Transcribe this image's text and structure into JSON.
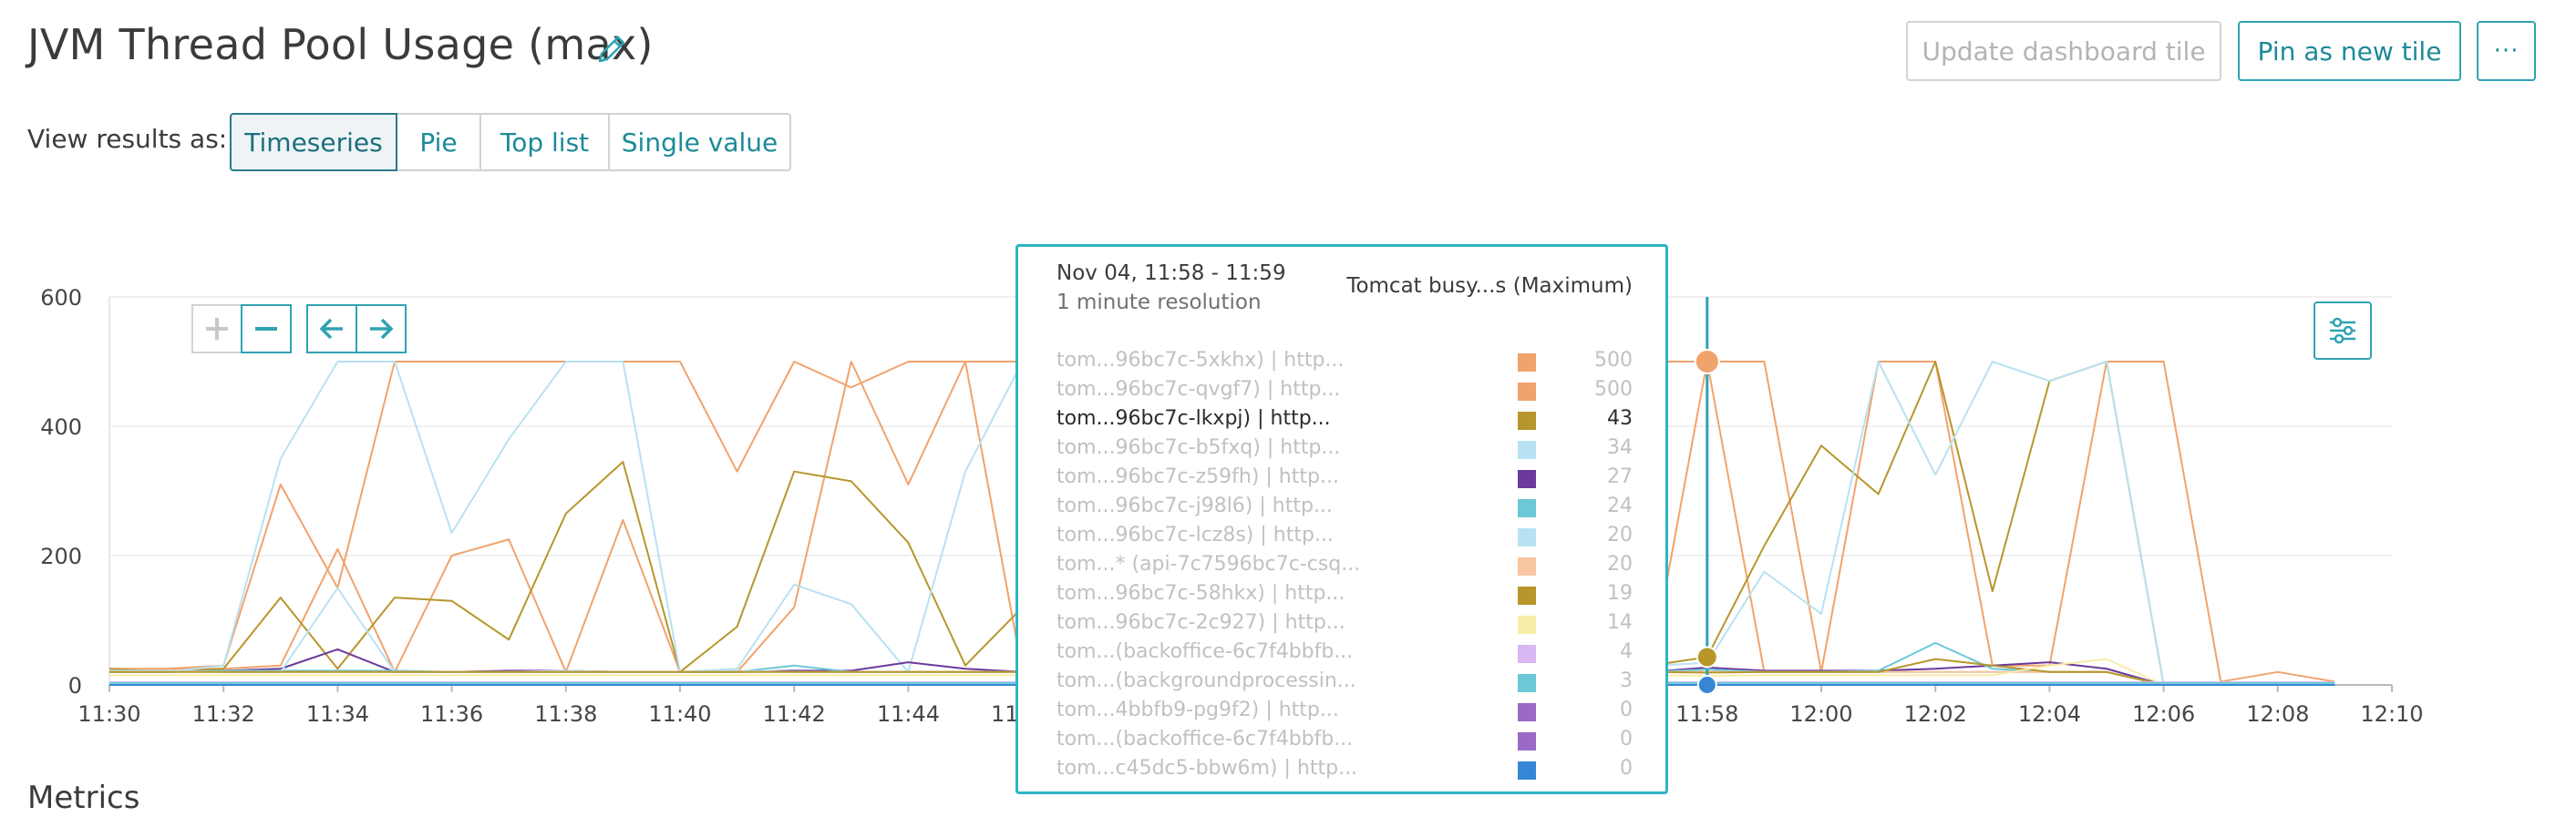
{
  "header": {
    "title": "JVM Thread Pool Usage (max)",
    "update_tile_label": "Update dashboard tile",
    "pin_tile_label": "Pin as new tile",
    "more_label": "···"
  },
  "view_results": {
    "label": "View results as:",
    "options": [
      "Timeseries",
      "Pie",
      "Top list",
      "Single value"
    ],
    "selected": "Timeseries"
  },
  "colors": {
    "accent": "#2fa3b2",
    "orange": "#f1a36c",
    "olive": "#b7962c",
    "light_blue": "#b8e2f2",
    "purple": "#6b3a9a",
    "teal": "#6cc7d7",
    "peach": "#f7c6a0",
    "pale_yellow": "#f8ecaa",
    "lavender": "#d8b7f2",
    "violet": "#9b6ac8",
    "blue": "#3587d6"
  },
  "chart_data": {
    "type": "line",
    "ylim": [
      0,
      600
    ],
    "yticks": [
      "0",
      "200",
      "400",
      "600"
    ],
    "xticks": [
      "11:30",
      "11:32",
      "11:34",
      "11:36",
      "11:38",
      "11:40",
      "11:42",
      "11:44",
      "11:46",
      "11:48",
      "11:50",
      "11:52",
      "11:54",
      "11:56",
      "11:58",
      "12:00",
      "12:02",
      "12:04",
      "12:06",
      "12:08",
      "12:10"
    ],
    "x": [
      "11:30",
      "11:31",
      "11:32",
      "11:33",
      "11:34",
      "11:35",
      "11:36",
      "11:37",
      "11:38",
      "11:39",
      "11:40",
      "11:41",
      "11:42",
      "11:43",
      "11:44",
      "11:45",
      "11:46",
      "11:47",
      "11:48",
      "11:49",
      "11:50",
      "11:51",
      "11:52",
      "11:53",
      "11:54",
      "11:55",
      "11:56",
      "11:57",
      "11:58",
      "11:59",
      "12:00",
      "12:01",
      "12:02",
      "12:03",
      "12:04",
      "12:05",
      "12:06",
      "12:07",
      "12:08",
      "12:09"
    ],
    "cursor": "11:58",
    "series": [
      {
        "name": "tom...96bc7c-5xkhx) | http...",
        "color": "#f1a36c",
        "values": [
          25,
          25,
          30,
          310,
          150,
          500,
          500,
          500,
          500,
          500,
          500,
          330,
          500,
          460,
          500,
          500,
          500,
          500,
          500,
          500,
          500,
          500,
          500,
          500,
          500,
          500,
          500,
          500,
          500,
          500,
          20,
          500,
          500,
          30,
          30,
          500,
          500,
          5,
          20,
          5
        ]
      },
      {
        "name": "tom...96bc7c-qvgf7) | http...",
        "color": "#f1a36c",
        "values": [
          20,
          25,
          25,
          30,
          210,
          20,
          200,
          225,
          20,
          255,
          20,
          20,
          120,
          500,
          310,
          500,
          20,
          20,
          20,
          20,
          20,
          20,
          20,
          20,
          20,
          20,
          20,
          20,
          500,
          20,
          20,
          20,
          20,
          20,
          20,
          20,
          0,
          0,
          0,
          0
        ]
      },
      {
        "name": "tom...96bc7c-lkxpj) | http...",
        "color": "#b7962c",
        "values": [
          25,
          20,
          25,
          135,
          25,
          135,
          130,
          70,
          265,
          345,
          20,
          90,
          330,
          315,
          220,
          30,
          120,
          30,
          30,
          30,
          30,
          30,
          30,
          30,
          30,
          30,
          30,
          30,
          43,
          215,
          370,
          295,
          500,
          145,
          470,
          500,
          0,
          0,
          0,
          0
        ]
      },
      {
        "name": "tom...96bc7c-b5fxq) | http...",
        "color": "#b8e2f2",
        "values": [
          20,
          20,
          30,
          350,
          500,
          500,
          235,
          380,
          500,
          500,
          20,
          25,
          155,
          125,
          20,
          330,
          500,
          500,
          30,
          30,
          30,
          30,
          30,
          30,
          30,
          30,
          30,
          30,
          34,
          175,
          110,
          500,
          325,
          500,
          470,
          500,
          0,
          0,
          0,
          0
        ]
      },
      {
        "name": "tom...96bc7c-z59fh) | http...",
        "color": "#6b3a9a",
        "values": [
          20,
          20,
          22,
          25,
          55,
          20,
          20,
          22,
          22,
          20,
          20,
          20,
          22,
          22,
          35,
          25,
          20,
          20,
          20,
          20,
          20,
          20,
          20,
          20,
          20,
          20,
          20,
          20,
          27,
          22,
          22,
          22,
          25,
          30,
          35,
          25,
          0,
          0,
          0,
          0
        ]
      },
      {
        "name": "tom...96bc7c-j98l6) | http...",
        "color": "#6cc7d7",
        "values": [
          20,
          20,
          22,
          22,
          22,
          22,
          20,
          20,
          20,
          20,
          20,
          20,
          30,
          20,
          20,
          20,
          20,
          20,
          20,
          20,
          20,
          20,
          20,
          20,
          20,
          20,
          20,
          20,
          24,
          20,
          20,
          22,
          65,
          25,
          20,
          20,
          0,
          0,
          0,
          0
        ]
      },
      {
        "name": "tom...96bc7c-lcz8s) | http...",
        "color": "#b8e2f2",
        "values": [
          22,
          22,
          20,
          20,
          150,
          20,
          20,
          20,
          22,
          20,
          20,
          22,
          20,
          20,
          20,
          20,
          20,
          20,
          20,
          20,
          20,
          20,
          20,
          20,
          20,
          20,
          20,
          20,
          20,
          20,
          20,
          20,
          20,
          20,
          20,
          20,
          0,
          0,
          0,
          0
        ]
      },
      {
        "name": "tom...* (api-7c7596bc7c-csq...",
        "color": "#f7c6a0",
        "values": [
          20,
          20,
          20,
          20,
          20,
          20,
          20,
          20,
          20,
          20,
          20,
          20,
          20,
          20,
          20,
          20,
          20,
          20,
          20,
          20,
          20,
          20,
          20,
          20,
          20,
          20,
          20,
          20,
          20,
          20,
          20,
          20,
          20,
          20,
          20,
          20,
          0,
          0,
          0,
          0
        ]
      },
      {
        "name": "tom...96bc7c-58hkx) | http...",
        "color": "#b7962c",
        "values": [
          20,
          20,
          20,
          20,
          20,
          20,
          20,
          20,
          20,
          20,
          20,
          20,
          20,
          20,
          20,
          20,
          20,
          20,
          20,
          20,
          20,
          20,
          20,
          20,
          20,
          20,
          20,
          20,
          19,
          20,
          20,
          20,
          40,
          30,
          20,
          20,
          0,
          0,
          0,
          0
        ]
      },
      {
        "name": "tom...96bc7c-2c927) | http...",
        "color": "#f8ecaa",
        "values": [
          15,
          15,
          15,
          15,
          15,
          15,
          15,
          15,
          15,
          15,
          15,
          15,
          15,
          15,
          15,
          15,
          15,
          15,
          15,
          15,
          15,
          15,
          15,
          15,
          15,
          15,
          15,
          15,
          14,
          15,
          15,
          15,
          15,
          15,
          30,
          40,
          0,
          0,
          0,
          0
        ]
      },
      {
        "name": "tom...(backoffice-6c7f4bbfb...",
        "color": "#d8b7f2",
        "values": [
          4,
          4,
          4,
          4,
          4,
          4,
          4,
          4,
          4,
          4,
          4,
          4,
          4,
          4,
          4,
          4,
          4,
          4,
          4,
          4,
          4,
          4,
          4,
          4,
          4,
          4,
          4,
          4,
          4,
          4,
          4,
          4,
          4,
          4,
          4,
          4,
          4,
          4,
          4,
          4
        ]
      },
      {
        "name": "tom...(backgroundprocessin...",
        "color": "#6cc7d7",
        "values": [
          3,
          3,
          3,
          3,
          3,
          3,
          3,
          3,
          3,
          3,
          3,
          3,
          3,
          3,
          3,
          3,
          3,
          3,
          3,
          3,
          3,
          3,
          3,
          3,
          3,
          3,
          3,
          3,
          3,
          3,
          3,
          3,
          3,
          3,
          3,
          3,
          3,
          3,
          3,
          3
        ]
      },
      {
        "name": "tom...4bbfb9-pg9f2) | http...",
        "color": "#9b6ac8",
        "values": [
          0,
          0,
          0,
          0,
          0,
          0,
          0,
          0,
          0,
          0,
          0,
          0,
          0,
          0,
          0,
          0,
          0,
          0,
          0,
          0,
          0,
          0,
          0,
          0,
          0,
          0,
          0,
          0,
          0,
          0,
          0,
          0,
          0,
          0,
          0,
          0,
          0,
          0,
          0,
          0
        ]
      },
      {
        "name": "tom...(backoffice-6c7f4bbfb...",
        "color": "#9b6ac8",
        "values": [
          0,
          0,
          0,
          0,
          0,
          0,
          0,
          0,
          0,
          0,
          0,
          0,
          0,
          0,
          0,
          0,
          0,
          0,
          0,
          0,
          0,
          0,
          0,
          0,
          0,
          0,
          0,
          0,
          0,
          0,
          0,
          0,
          0,
          0,
          0,
          0,
          0,
          0,
          0,
          0
        ]
      },
      {
        "name": "tom...c45dc5-bbw6m) | http...",
        "color": "#3587d6",
        "values": [
          0,
          0,
          0,
          0,
          0,
          0,
          0,
          0,
          0,
          0,
          0,
          0,
          0,
          0,
          0,
          0,
          0,
          0,
          0,
          0,
          0,
          0,
          0,
          0,
          0,
          0,
          0,
          0,
          0,
          0,
          0,
          0,
          0,
          0,
          0,
          0,
          0,
          0,
          0,
          0
        ]
      }
    ]
  },
  "tooltip": {
    "date": "Nov 04, 11:58 - 11:59",
    "resolution": "1 minute resolution",
    "header": "Tomcat busy...s (Maximum)",
    "highlighted_index": 2,
    "rows": [
      {
        "name": "tom...96bc7c-5xkhx) | http...",
        "color": "#f1a36c",
        "value": "500"
      },
      {
        "name": "tom...96bc7c-qvgf7) | http...",
        "color": "#f1a36c",
        "value": "500"
      },
      {
        "name": "tom...96bc7c-lkxpj) | http...",
        "color": "#b7962c",
        "value": "43"
      },
      {
        "name": "tom...96bc7c-b5fxq) | http...",
        "color": "#b8e2f2",
        "value": "34"
      },
      {
        "name": "tom...96bc7c-z59fh) | http...",
        "color": "#6b3a9a",
        "value": "27"
      },
      {
        "name": "tom...96bc7c-j98l6) | http...",
        "color": "#6cc7d7",
        "value": "24"
      },
      {
        "name": "tom...96bc7c-lcz8s) | http...",
        "color": "#b8e2f2",
        "value": "20"
      },
      {
        "name": "tom...* (api-7c7596bc7c-csq...",
        "color": "#f7c6a0",
        "value": "20"
      },
      {
        "name": "tom...96bc7c-58hkx) | http...",
        "color": "#b7962c",
        "value": "19"
      },
      {
        "name": "tom...96bc7c-2c927) | http...",
        "color": "#f8ecaa",
        "value": "14"
      },
      {
        "name": "tom...(backoffice-6c7f4bbfb...",
        "color": "#d8b7f2",
        "value": "4"
      },
      {
        "name": "tom...(backgroundprocessin...",
        "color": "#6cc7d7",
        "value": "3"
      },
      {
        "name": "tom...4bbfb9-pg9f2) | http...",
        "color": "#9b6ac8",
        "value": "0"
      },
      {
        "name": "tom...(backoffice-6c7f4bbfb...",
        "color": "#9b6ac8",
        "value": "0"
      },
      {
        "name": "tom...c45dc5-bbw6m) | http...",
        "color": "#3587d6",
        "value": "0"
      }
    ]
  },
  "metrics": {
    "heading": "Metrics"
  }
}
